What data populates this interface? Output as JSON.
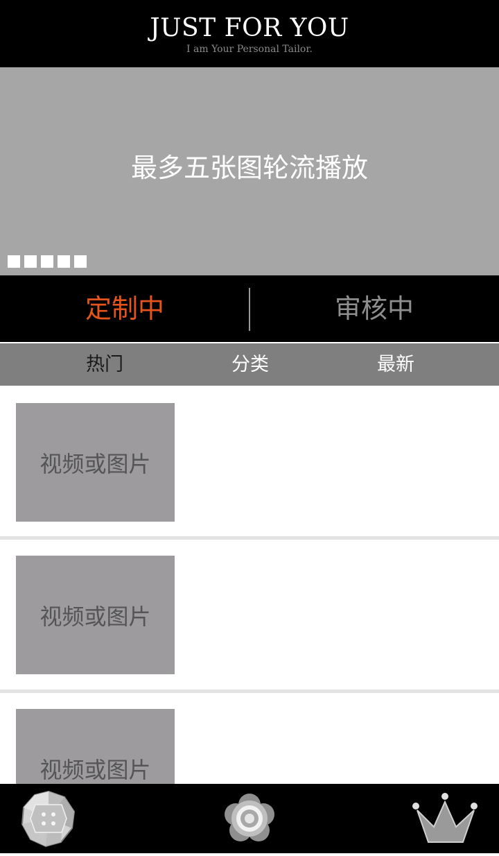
{
  "header": {
    "title": "JUST FOR YOU",
    "subtitle": "I am Your Personal Tailor."
  },
  "banner": {
    "text": "最多五张图轮流播放",
    "dot_count": 5
  },
  "status_tabs": [
    {
      "label": "定制中",
      "active": true
    },
    {
      "label": "审核中",
      "active": false
    }
  ],
  "sub_tabs": [
    "热门",
    "分类",
    "最新"
  ],
  "items": [
    {
      "thumb_label": "视频或图片"
    },
    {
      "thumb_label": "视频或图片"
    },
    {
      "thumb_label": "视频或图片"
    }
  ],
  "bottom_nav": [
    {
      "icon": "gem-button-icon"
    },
    {
      "icon": "flower-target-icon"
    },
    {
      "icon": "crown-icon"
    }
  ],
  "colors": {
    "active_tab": "#e4541c",
    "inactive_tab": "#8e8e8e",
    "banner_bg": "#a6a6a6",
    "thumb_bg": "#9d9b9e"
  }
}
